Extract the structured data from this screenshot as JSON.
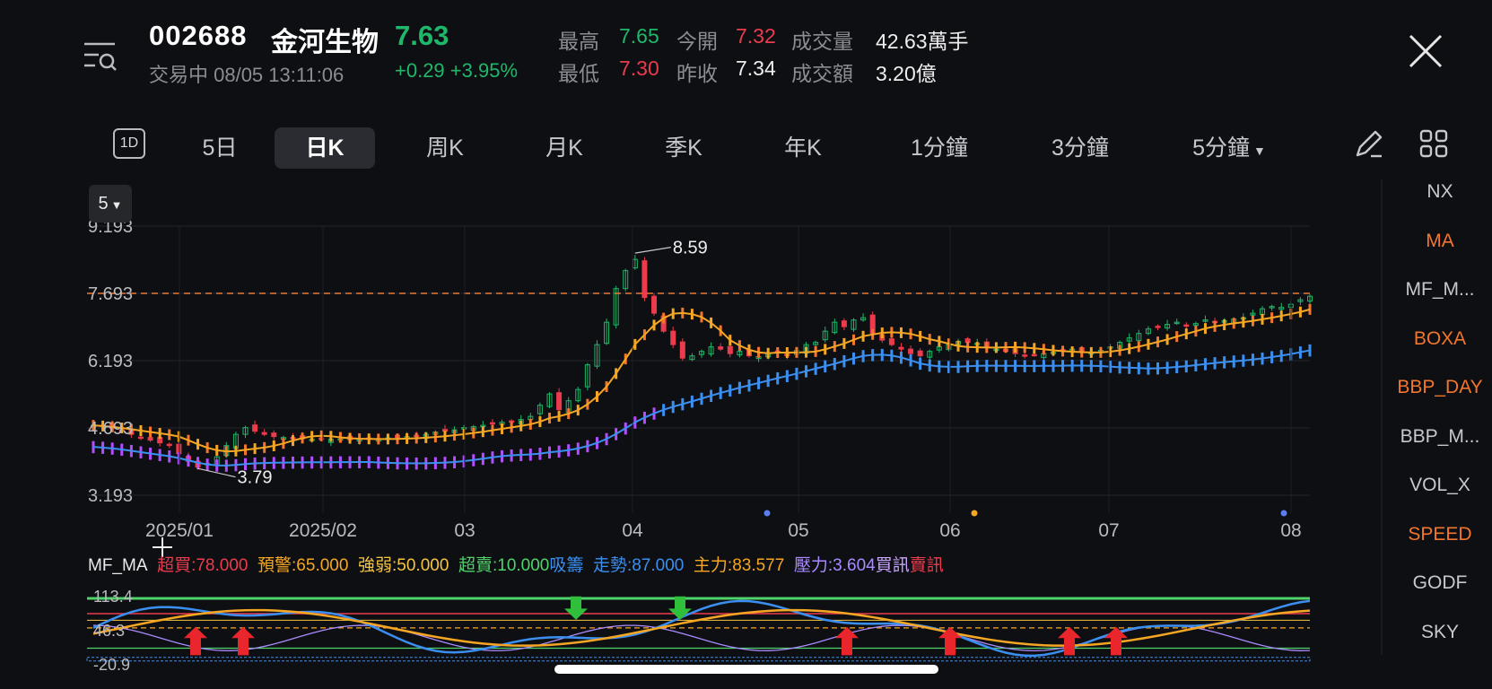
{
  "header": {
    "code": "002688",
    "name": "金河生物",
    "price": "7.63",
    "status": "交易中 08/05 13:11:06",
    "change": "+0.29 +3.95%",
    "quote": {
      "high_label": "最高",
      "high": "7.65",
      "open_label": "今開",
      "open": "7.32",
      "volume_label": "成交量",
      "volume": "42.63萬手",
      "low_label": "最低",
      "low": "7.30",
      "prev_label": "昨收",
      "prev": "7.34",
      "amount_label": "成交額",
      "amount": "3.20億"
    }
  },
  "tabs": {
    "box": "1D",
    "t5d": "5日",
    "day": "日K",
    "week": "周K",
    "month": "月K",
    "quarter": "季K",
    "year": "年K",
    "m1": "1分鐘",
    "m3": "3分鐘",
    "m5": "5分鐘"
  },
  "period_select": "5",
  "indicators": [
    "NX",
    "MA",
    "MF_M...",
    "BOXA",
    "BBP_DAY",
    "BBP_M...",
    "VOL_X",
    "SPEED",
    "GODF",
    "SKY"
  ],
  "indicators_active": [
    false,
    true,
    false,
    true,
    true,
    false,
    false,
    true,
    false,
    false
  ],
  "colors": {
    "up": "#1fb86b",
    "down": "#ec3b4d",
    "accent": "#f2762e",
    "ma_fast": "#f5a623",
    "ma_slow": "#3b8ff0"
  },
  "icons": {
    "menu": "search-list-icon",
    "close": "close-icon",
    "draw": "pencil-icon",
    "layout": "grid-icon",
    "dropdown": "caret-down-icon"
  },
  "chart_data": {
    "type": "candlestick",
    "price_axis": [
      "9.193",
      "7.693",
      "6.193",
      "4.693",
      "3.193"
    ],
    "ylim": [
      3.193,
      9.193
    ],
    "date_ticks": [
      "2025/01",
      "2025/02",
      "03",
      "04",
      "05",
      "06",
      "07",
      "08"
    ],
    "current_price_line": 7.693,
    "annotations": {
      "high": "8.59",
      "low": "3.79"
    },
    "close": [
      4.75,
      4.72,
      4.68,
      4.62,
      4.55,
      4.48,
      4.42,
      4.36,
      4.3,
      4.12,
      3.95,
      3.82,
      3.9,
      4.05,
      4.3,
      4.55,
      4.7,
      4.62,
      4.55,
      4.5,
      4.48,
      4.46,
      4.45,
      4.44,
      4.43,
      4.44,
      4.45,
      4.43,
      4.44,
      4.46,
      4.45,
      4.47,
      4.48,
      4.5,
      4.52,
      4.55,
      4.6,
      4.62,
      4.65,
      4.7,
      4.72,
      4.75,
      4.8,
      4.82,
      4.85,
      4.88,
      4.95,
      5.2,
      5.45,
      5.1,
      5.3,
      5.55,
      6.1,
      6.55,
      7.05,
      7.8,
      8.2,
      8.45,
      7.6,
      7.25,
      6.85,
      6.55,
      6.25,
      6.3,
      6.4,
      6.5,
      6.45,
      6.35,
      6.4,
      6.3,
      6.28,
      6.35,
      6.4,
      6.3,
      6.42,
      6.55,
      6.6,
      6.85,
      7.05,
      6.95,
      7.1,
      7.15,
      6.8,
      6.65,
      6.55,
      6.45,
      6.35,
      6.3,
      6.4,
      6.5,
      6.55,
      6.62,
      6.6,
      6.58,
      6.5,
      6.45,
      6.4,
      6.35,
      6.3,
      6.32,
      6.35,
      6.38,
      6.42,
      6.45,
      6.4,
      6.38,
      6.42,
      6.5,
      6.6,
      6.7,
      6.8,
      6.9,
      6.95,
      7.0,
      7.05,
      6.98,
      7.02,
      7.1,
      7.05,
      7.08,
      7.12,
      7.15,
      7.25,
      7.35,
      7.4,
      7.38,
      7.45,
      7.55,
      7.63
    ],
    "ma_fast_label": "MA",
    "mf_ma": {
      "name": "MF_MA",
      "overbought": "超買:78.000",
      "warning": "預警:65.000",
      "strength": "強弱:50.000",
      "oversold": "超賣:10.000",
      "absorb": "吸籌",
      "trend": "走勢:87.000",
      "main_force": "主力:83.577",
      "pressure": "壓力:3.604",
      "buy_signal": "買訊",
      "sell_signal": "賣訊",
      "axis": [
        "113.4",
        "46.3",
        "-20.9"
      ],
      "ylim": [
        -20.9,
        113.4
      ]
    }
  }
}
